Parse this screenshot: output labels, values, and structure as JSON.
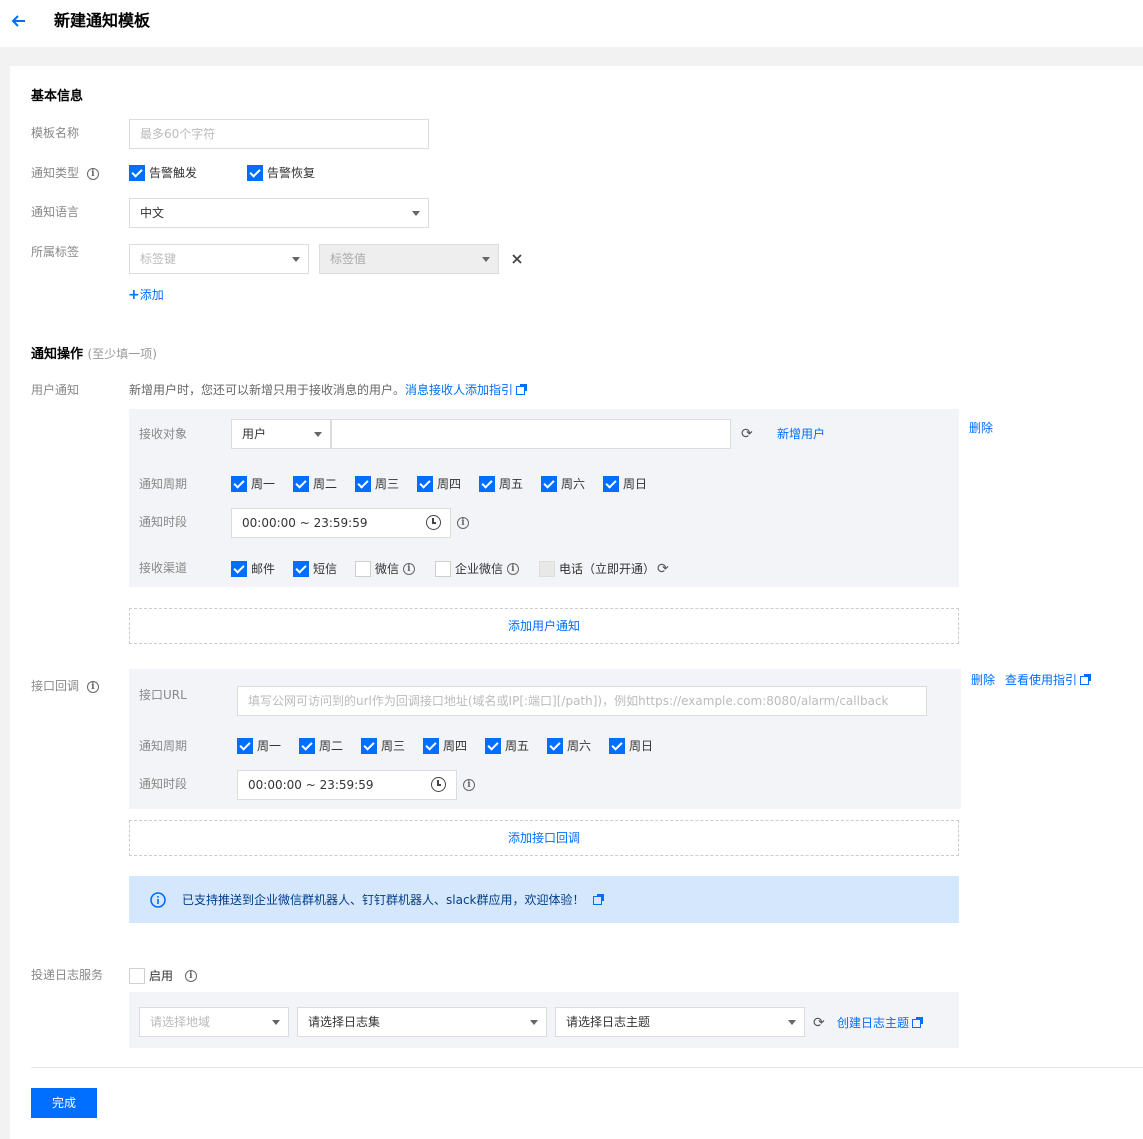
{
  "header": {
    "title": "新建通知模板"
  },
  "basic": {
    "section_title": "基本信息",
    "name_label": "模板名称",
    "name_placeholder": "最多60个字符",
    "type_label": "通知类型",
    "type_options": [
      {
        "label": "告警触发",
        "checked": true
      },
      {
        "label": "告警恢复",
        "checked": true
      }
    ],
    "lang_label": "通知语言",
    "lang_value": "中文",
    "tag_label": "所属标签",
    "tag_key_placeholder": "标签键",
    "tag_value_placeholder": "标签值",
    "add_label": "添加"
  },
  "ops": {
    "section_title": "通知操作",
    "section_sub": "(至少填一项)",
    "user": {
      "label": "用户通知",
      "desc": "新增用户时，您还可以新增只用于接收消息的用户。",
      "guide_link": "消息接收人添加指引",
      "recv_label": "接收对象",
      "recv_type": "用户",
      "new_user": "新增用户",
      "delete": "删除",
      "period_label": "通知周期",
      "days": [
        "周一",
        "周二",
        "周三",
        "周四",
        "周五",
        "周六",
        "周日"
      ],
      "time_label": "通知时段",
      "time_value": "00:00:00 ~ 23:59:59",
      "channel_label": "接收渠道",
      "channels": [
        {
          "label": "邮件",
          "state": "on"
        },
        {
          "label": "短信",
          "state": "on"
        },
        {
          "label": "微信",
          "state": "off"
        },
        {
          "label": "企业微信",
          "state": "off"
        },
        {
          "label": "电话（立即开通）",
          "state": "dis"
        }
      ],
      "add_btn": "添加用户通知"
    },
    "callback": {
      "label": "接口回调",
      "url_label": "接口URL",
      "url_placeholder": "填写公网可访问到的url作为回调接口地址(域名或IP[:端口][/path])，例如https://example.com:8080/alarm/callback",
      "delete": "删除",
      "guide": "查看使用指引",
      "period_label": "通知周期",
      "days": [
        "周一",
        "周二",
        "周三",
        "周四",
        "周五",
        "周六",
        "周日"
      ],
      "time_label": "通知时段",
      "time_value": "00:00:00 ~ 23:59:59",
      "add_btn": "添加接口回调"
    },
    "notice": "已支持推送到企业微信群机器人、钉钉群机器人、slack群应用，欢迎体验！"
  },
  "log": {
    "label": "投递日志服务",
    "enable": "启用",
    "region_placeholder": "请选择地域",
    "logset": "请选择日志集",
    "topic": "请选择日志主题",
    "create_link": "创建日志主题"
  },
  "footer": {
    "done": "完成"
  },
  "colors": {
    "primary": "#006eff",
    "notice_bg": "#d5e7fc"
  }
}
